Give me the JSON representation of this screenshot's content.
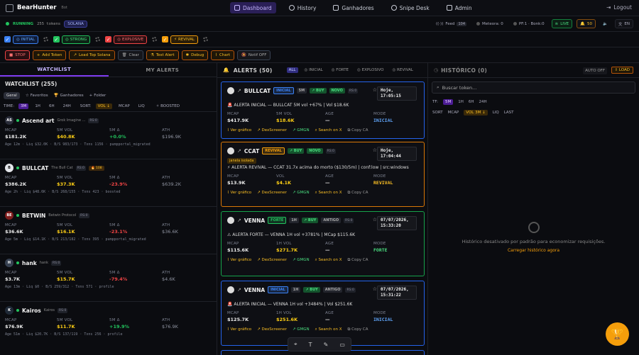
{
  "nav": {
    "logo": "BearHunter",
    "logo_sub": "Bot",
    "links": [
      {
        "label": "Dashboard",
        "active": true
      },
      {
        "label": "History"
      },
      {
        "label": "Ganhadores"
      },
      {
        "label": "Snipe Desk"
      },
      {
        "label": "Admin"
      }
    ],
    "logout": "Logout"
  },
  "status": {
    "running": "RUNNING",
    "tokens": "255 tokens",
    "chain": "SOLANA",
    "feed": "Feed",
    "feed_count": "104",
    "meteora": "Meteora: 0",
    "pf": "PF:1 · Bonk:0",
    "live": "LIVE",
    "bell_count": "50",
    "lang": "EN"
  },
  "filters": [
    {
      "label": "INITIAL",
      "color": "#3b82f6"
    },
    {
      "label": "STRONG",
      "color": "#22c55e"
    },
    {
      "label": "EXPLOSIVE",
      "color": "#ef4444"
    },
    {
      "label": "REVIVAL",
      "color": "#f59e0b"
    }
  ],
  "actions": [
    {
      "label": "STOP",
      "color": "#ef4444"
    },
    {
      "label": "Add Token",
      "color": "#f59e0b"
    },
    {
      "label": "Load Top Solana",
      "color": "#f59e0b"
    },
    {
      "label": "Clear",
      "color": "#6b7280"
    },
    {
      "label": "Test Alert",
      "color": "#f59e0b"
    },
    {
      "label": "Debug",
      "color": "#f59e0b"
    },
    {
      "label": "Chart",
      "color": "#f59e0b"
    },
    {
      "label": "Notif OFF",
      "color": "#6b7280"
    }
  ],
  "watchlist": {
    "tab_watchlist": "WATCHLIST",
    "tab_alerts": "MY ALERTS",
    "header": "WATCHLIST (255)",
    "subtabs": [
      "Geral",
      "Favoritos",
      "Ganhadores",
      "Folder"
    ],
    "time_label": "TIME:",
    "times": [
      "3M",
      "1H",
      "6H",
      "24H"
    ],
    "sort_label": "SORT:",
    "sorts": [
      "VOL ↓",
      "MCAP",
      "LIQ"
    ],
    "boosted": "BOOSTED",
    "col_mcap": "MCAP",
    "col_vol": "5M VOL",
    "col_delta": "5M Δ",
    "col_ath": "ATH",
    "items": [
      {
        "avatar": "AS",
        "name": "Ascend art",
        "full": "Grok Imagine ...",
        "badge": "RS:0",
        "mcap": "$181.2K",
        "vol": "$40.8K",
        "delta": "+0.0%",
        "delta_dir": "up",
        "ath": "$196.9K",
        "meta": "Age 12m · Liq $32.0K · B/S 983/173 · Txns 1156 · pumpportal_migrated"
      },
      {
        "avatar": "B",
        "name": "BULLCAT",
        "full": "The Bull Cat",
        "badge": "RS:0",
        "fire": "🔥 108",
        "mcap": "$386.2K",
        "vol": "$37.3K",
        "delta": "-23.9%",
        "delta_dir": "dn",
        "ath": "$639.2K",
        "meta": "Age 2h · Liq $48.6K · B/S 268/155 · Txns 423 · boosted"
      },
      {
        "avatar": "BE",
        "name": "BETWIN",
        "full": "Betwin Protocol",
        "badge": "RS:0",
        "mcap": "$36.6K",
        "vol": "$16.1K",
        "delta": "-23.1%",
        "delta_dir": "dn",
        "ath": "$36.6K",
        "meta": "Age 5m · Liq $14.1K · B/S 213/182 · Txns 395 · pumpportal_migrated"
      },
      {
        "avatar": "H",
        "name": "hank",
        "full": "hank",
        "badge": "RS:0",
        "mcap": "$3.7K",
        "vol": "$15.7K",
        "delta": "-79.4%",
        "delta_dir": "dn",
        "ath": "$4.6K",
        "meta": "Age 13m · Liq $0 · B/S 259/312 · Txns 571 · profile"
      },
      {
        "avatar": "K",
        "name": "Kairos",
        "full": "Kairos",
        "badge": "RS:0",
        "mcap": "$76.9K",
        "vol": "$11.7K",
        "delta": "+19.9%",
        "delta_dir": "up",
        "ath": "$76.9K",
        "meta": "Age 51m · Liq $20.7K · B/S 137/119 · Txns 256 · profile"
      }
    ]
  },
  "alerts": {
    "title": "ALERTS (50)",
    "filters": [
      "ALL",
      "INICIAL",
      "FORTE",
      "EXPLOSIVO",
      "REVIVAL"
    ],
    "items": [
      {
        "name": "BULLCAT",
        "type": "INICIAL",
        "type_color": "#3b82f6",
        "tf": "5M",
        "dir": "BUY",
        "age_tag": "NOVO",
        "rs": "RS:0",
        "time": "Hoje, 17:05:15",
        "msg": "🚨 ALERTA INICIAL — BULLCAT 5M vol +67% | Vol $18.6K",
        "mcap": "$417.9K",
        "vol_label": "5M VOL",
        "vol": "$18.6K",
        "age": "—",
        "mode": "INICIAL",
        "border": "#2563eb",
        "mode_color": "#60a5fa"
      },
      {
        "name": "CCAT",
        "type": "REVIVAL",
        "type_color": "#f59e0b",
        "tf": "",
        "dir": "BUY",
        "age_tag": "NOVO",
        "rs": "RS:0",
        "time": "Hoje, 17:04:44",
        "note": "janela isolada",
        "msg": "⚡ ALERTA REVIVAL — CCAT 31.7x acima do morto ($130/5m) | conf:low | src:windows",
        "mcap": "$13.9K",
        "vol_label": "VOL",
        "vol": "$4.1K",
        "age": "—",
        "mode": "REVIVAL",
        "border": "#d97706",
        "mode_color": "#fbbf24"
      },
      {
        "name": "VENNA",
        "type": "FORTE",
        "type_color": "#22c55e",
        "tf": "1H",
        "dir": "BUY",
        "age_tag": "ANTIGO",
        "rs": "RS:0",
        "time": "07/07/2026, 15:33:20",
        "msg": "⚠ ALERTA FORTE — VENNA 1H vol +3781% | MCap $115.6K",
        "mcap": "$115.6K",
        "vol_label": "1H VOL",
        "vol": "$271.7K",
        "age": "—",
        "mode": "FORTE",
        "border": "#16a34a",
        "mode_color": "#4ade80"
      },
      {
        "name": "VENNA",
        "type": "INICIAL",
        "type_color": "#3b82f6",
        "tf": "1H",
        "dir": "BUY",
        "age_tag": "ANTIGO",
        "rs": "RS:0",
        "time": "07/07/2026, 15:31:22",
        "msg": "🚨 ALERTA INICIAL — VENNA 1H vol +3484% | Vol $251.6K",
        "mcap": "$125.7K",
        "vol_label": "1H VOL",
        "vol": "$251.6K",
        "age": "—",
        "mode": "INICIAL",
        "border": "#2563eb",
        "mode_color": "#60a5fa"
      }
    ],
    "col_mcap": "MCAP",
    "col_age": "AGE",
    "col_mode": "MODE",
    "link_chart": "Ver gráfico",
    "link_dex": "DexScreener",
    "link_gmgn": "GMGN",
    "link_x": "Search on X",
    "link_ca": "Copy CA"
  },
  "history": {
    "title": "HISTÓRICO (0)",
    "auto": "AUTO OFF",
    "load": "LOAD",
    "search_placeholder": "Buscar token...",
    "tf_label": "TF:",
    "tfs": [
      "5M",
      "1H",
      "6H",
      "24H"
    ],
    "sort_label": "SORT",
    "sorts": [
      "MCAP",
      "VOL 3M ↓",
      "LIQ",
      "LAST"
    ],
    "empty": "Histórico desativado por padrão para economizar requisições.",
    "load_link": "Carregar histórico agora"
  }
}
